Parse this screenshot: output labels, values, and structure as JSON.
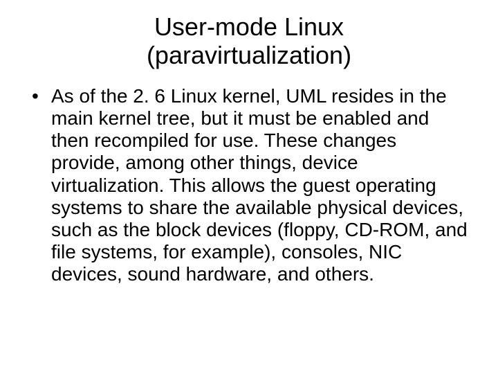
{
  "title_line1": "User-mode Linux",
  "title_line2": "(paravirtualization)",
  "bullets": [
    "As of the 2. 6 Linux kernel, UML resides in the main kernel tree, but it must be enabled and then recompiled for use. These changes provide, among other things, device virtualization. This allows the guest operating systems to share the available physical devices, such as the block devices (floppy, CD-ROM, and file systems, for example), consoles, NIC devices, sound hardware, and others."
  ]
}
